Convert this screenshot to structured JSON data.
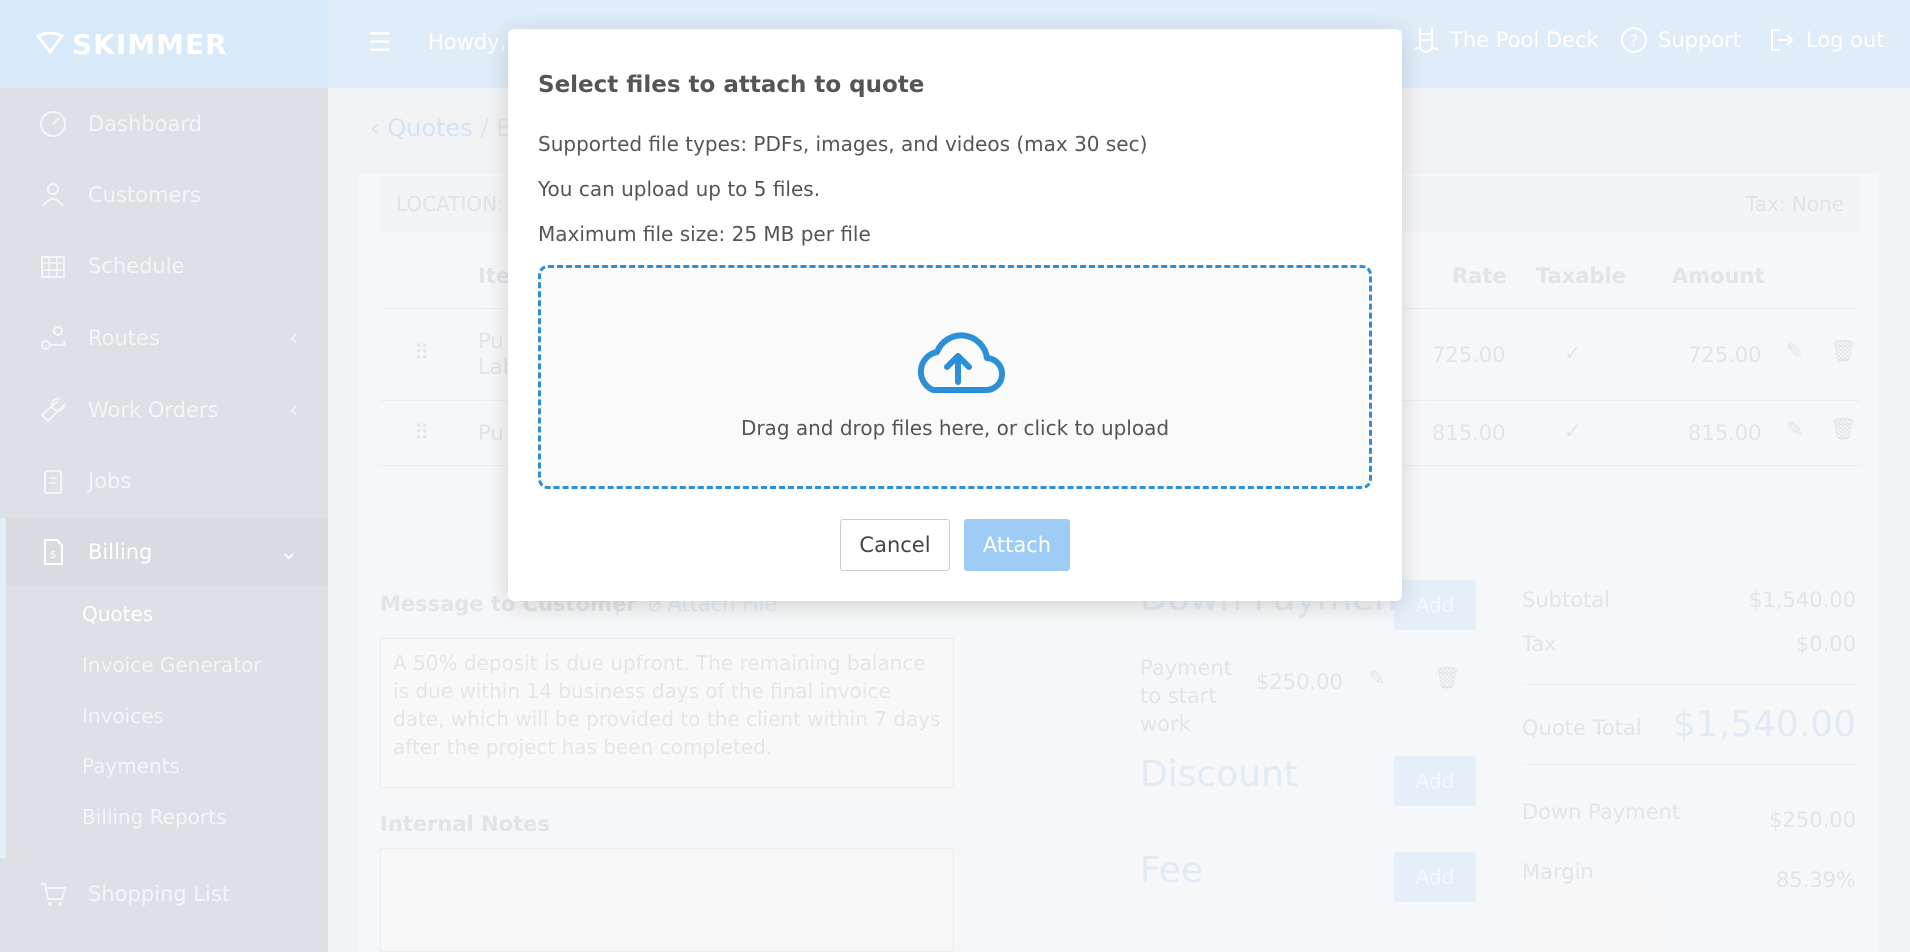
{
  "header": {
    "logo": "SKIMMER",
    "greeting": "Howdy,",
    "nav": [
      {
        "label": "The Pool Deck",
        "icon": "pool-ladder-icon"
      },
      {
        "label": "Support",
        "icon": "help-circle-icon"
      },
      {
        "label": "Log out",
        "icon": "logout-icon"
      }
    ]
  },
  "sidebar": {
    "items": [
      {
        "label": "Dashboard",
        "icon": "dashboard-icon"
      },
      {
        "label": "Customers",
        "icon": "customers-icon"
      },
      {
        "label": "Schedule",
        "icon": "calendar-icon"
      },
      {
        "label": "Routes",
        "icon": "route-icon"
      },
      {
        "label": "Work Orders",
        "icon": "wrench-icon"
      },
      {
        "label": "Jobs",
        "icon": "clipboard-icon"
      },
      {
        "label": "Billing",
        "icon": "invoice-icon"
      },
      {
        "label": "Shopping List",
        "icon": "cart-icon"
      }
    ],
    "billing_sub": [
      "Quotes",
      "Invoice Generator",
      "Invoices",
      "Payments",
      "Billing Reports"
    ]
  },
  "page": {
    "breadcrumb": "Quotes",
    "breadcrumb_sep": "/",
    "breadcrumb_next": "E",
    "location_label": "LOCATION:",
    "tax_label": "Tax: None",
    "columns": {
      "item": "Ite",
      "rate": "Rate",
      "taxable": "Taxable",
      "amount": "Amount"
    },
    "rows": [
      {
        "item": "Pu",
        "item2": "Lab",
        "rate": "725.00",
        "amount": "725.00"
      },
      {
        "item": "Pu",
        "item2": "",
        "rate": "815.00",
        "amount": "815.00"
      }
    ],
    "message_label": "Message to Customer",
    "attach_file": "Attach File",
    "message_text": "A 50% deposit is due upfront. The remaining balance is due within 14 business days of the final invoice date, which will be provided to the client within 7 days after the project has been completed.",
    "internal_notes": "Internal Notes",
    "down_payment": "Down Payment",
    "payment_to_start": "Payment to start work",
    "payment_amount": "$250.00",
    "discount": "Discount",
    "fee": "Fee",
    "add": "Add",
    "summary": {
      "subtotal_label": "Subtotal",
      "subtotal": "$1,540.00",
      "tax_label": "Tax",
      "tax": "$0.00",
      "total_label": "Quote Total",
      "total": "$1,540.00",
      "down_label": "Down Payment",
      "down": "$250.00",
      "margin_label": "Margin",
      "margin": "85.39%"
    }
  },
  "modal": {
    "title": "Select files to attach to quote",
    "line1": "Supported file types: PDFs, images, and videos (max 30 sec)",
    "line2": "You can upload up to 5 files.",
    "line3": "Maximum file size: 25 MB per file",
    "drop_text": "Drag and drop files here, or click to upload",
    "cancel": "Cancel",
    "attach": "Attach"
  }
}
